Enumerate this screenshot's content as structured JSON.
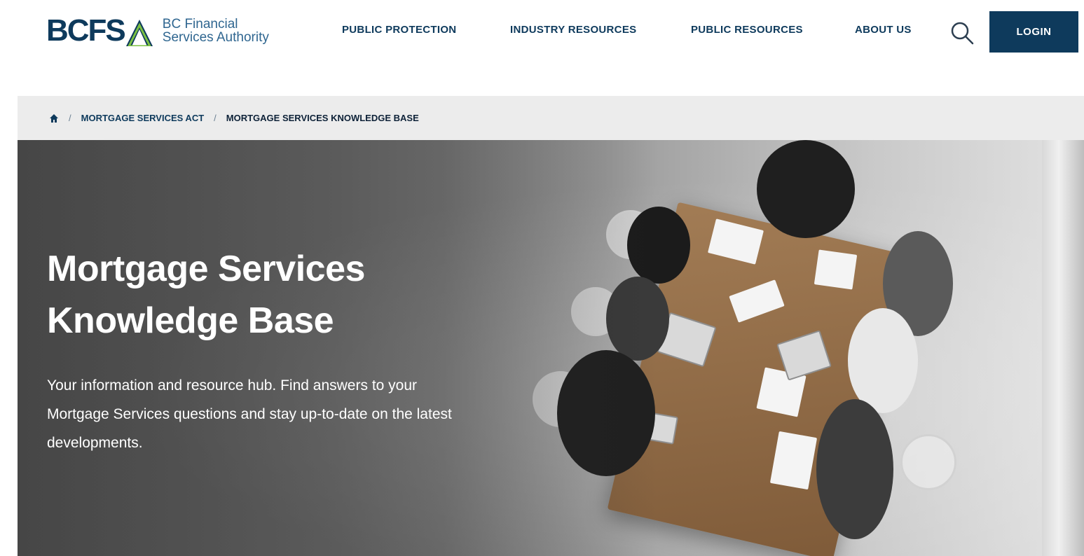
{
  "brand": {
    "mark": "BCFS",
    "name_line1": "BC Financial",
    "name_line2": "Services Authority",
    "colors": {
      "navy": "#0e3a5c",
      "green": "#7cc142",
      "text_blue": "#2f6690"
    }
  },
  "nav": {
    "items": [
      {
        "label": "PUBLIC PROTECTION"
      },
      {
        "label": "INDUSTRY RESOURCES"
      },
      {
        "label": "PUBLIC RESOURCES"
      },
      {
        "label": "ABOUT US"
      }
    ],
    "search_icon": "search-icon",
    "login_label": "LOGIN"
  },
  "breadcrumb": {
    "home_icon": "home-icon",
    "separator": "/",
    "items": [
      {
        "label": "MORTGAGE SERVICES ACT"
      },
      {
        "label": "MORTGAGE SERVICES KNOWLEDGE BASE"
      }
    ]
  },
  "hero": {
    "title_line1": "Mortgage Services",
    "title_line2": "Knowledge Base",
    "description_line1": "Your information and resource hub. Find answers to your",
    "description_line2": "Mortgage Services questions and stay up-to-date on the latest",
    "description_line3": "developments."
  }
}
